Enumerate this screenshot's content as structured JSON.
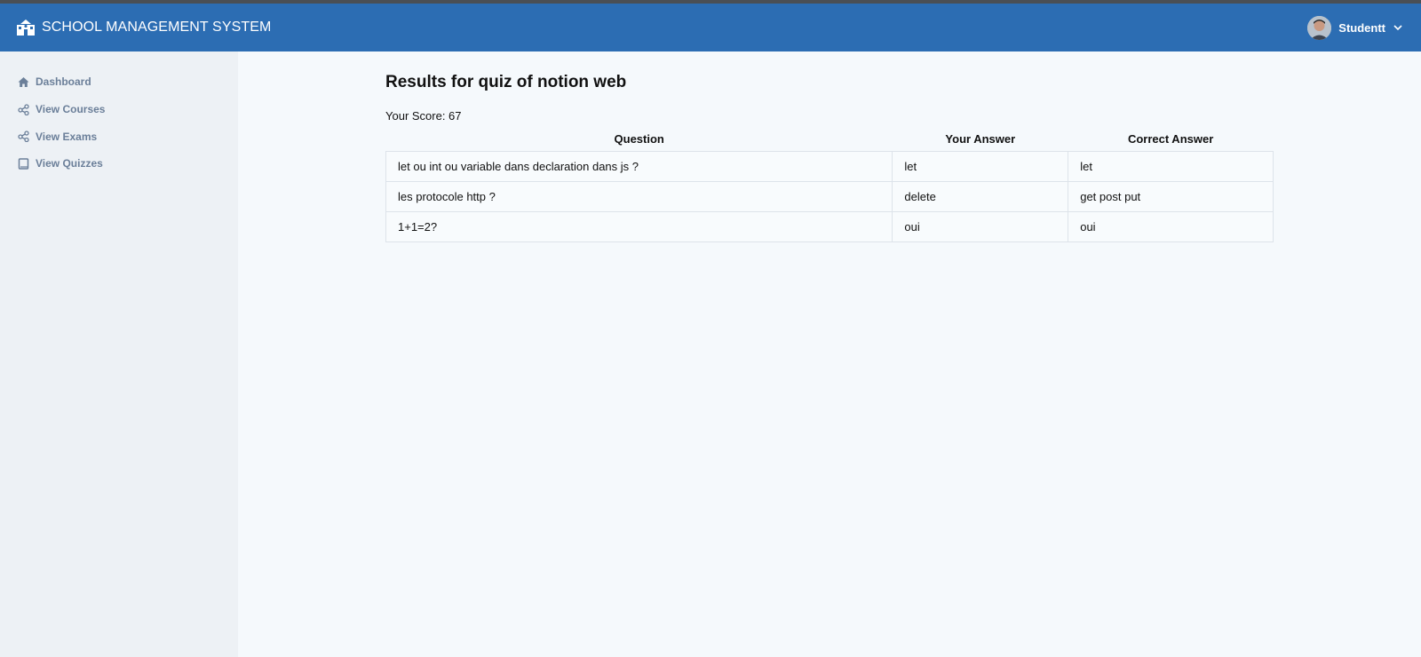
{
  "header": {
    "brand": "SCHOOL MANAGEMENT SYSTEM",
    "user_name": "Studentt"
  },
  "sidebar": {
    "items": [
      {
        "label": "Dashboard",
        "icon": "home-icon"
      },
      {
        "label": "View Courses",
        "icon": "share-nodes-icon"
      },
      {
        "label": "View Exams",
        "icon": "share-nodes-icon"
      },
      {
        "label": "View Quizzes",
        "icon": "book-icon"
      }
    ]
  },
  "main": {
    "title": "Results for quiz of notion web",
    "score_label": "Your Score: 67",
    "table": {
      "headers": [
        "Question",
        "Your Answer",
        "Correct Answer"
      ],
      "rows": [
        [
          "let ou int ou variable dans declaration dans js ?",
          "let",
          "let"
        ],
        [
          "les protocole http ?",
          "delete",
          "get post put"
        ],
        [
          "1+1=2?",
          "oui",
          "oui"
        ]
      ]
    }
  },
  "colors": {
    "navbar": "#2c6db3",
    "sidebar_bg": "#edf1f5",
    "sidebar_text": "#6b7f99",
    "page_bg": "#f5f9fc"
  }
}
